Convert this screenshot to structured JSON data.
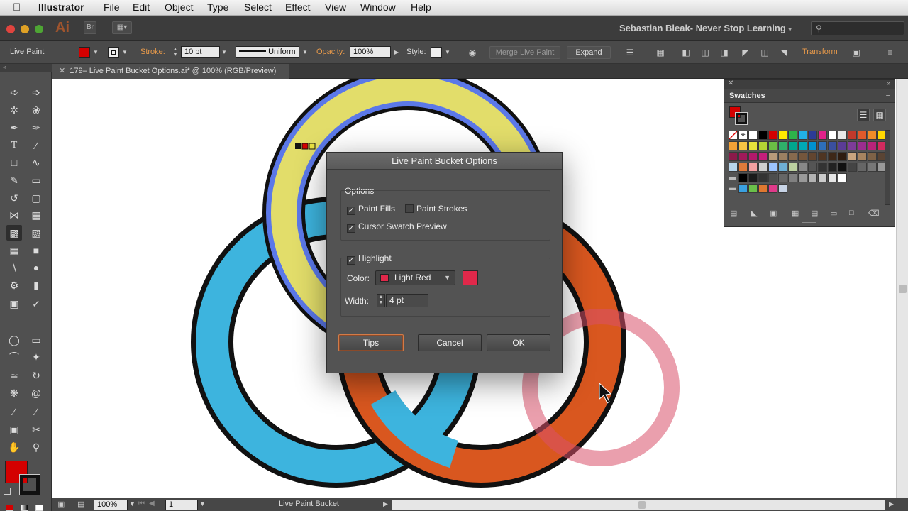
{
  "menubar": {
    "app_name": "Illustrator",
    "items": [
      "File",
      "Edit",
      "Object",
      "Type",
      "Select",
      "Effect",
      "View",
      "Window",
      "Help"
    ]
  },
  "appbar": {
    "logo": "Ai",
    "bridge_label": "Br",
    "workspace": "Sebastian Bleak- Never Stop Learning"
  },
  "controlbar": {
    "mode_label": "Live Paint",
    "stroke_label": "Stroke:",
    "stroke_value": "10 pt",
    "profile_value": "Uniform",
    "opacity_label": "Opacity:",
    "opacity_value": "100%",
    "style_label": "Style:",
    "merge_label": "Merge Live Paint",
    "expand_label": "Expand",
    "transform_label": "Transform",
    "fill_color": "#d40000"
  },
  "doc_tab": {
    "title": "179– Live Paint Bucket Options.ai* @ 100% (RGB/Preview)"
  },
  "statusbar": {
    "zoom": "100%",
    "artboard": "1",
    "tool_name": "Live Paint Bucket"
  },
  "swatches": {
    "title": "Swatches",
    "fill_color": "#d40000"
  },
  "dialog": {
    "title": "Live Paint Bucket Options",
    "options_label": "Options",
    "paint_fills_label": "Paint Fills",
    "paint_fills_checked": true,
    "paint_strokes_label": "Paint Strokes",
    "paint_strokes_checked": false,
    "cursor_preview_label": "Cursor Swatch Preview",
    "cursor_preview_checked": true,
    "highlight_label": "Highlight",
    "highlight_checked": true,
    "color_label": "Color:",
    "color_value": "Light Red",
    "color_hex": "#e0284a",
    "width_label": "Width:",
    "width_value": "4 pt",
    "tips_label": "Tips",
    "cancel_label": "Cancel",
    "ok_label": "OK"
  },
  "artwork": {
    "colors": {
      "yellow": "#e2dd6a",
      "blue": "#5b78e8",
      "cyan": "#3db4de",
      "orange": "#d9571f",
      "highlight_ring": "#d8506a"
    }
  }
}
